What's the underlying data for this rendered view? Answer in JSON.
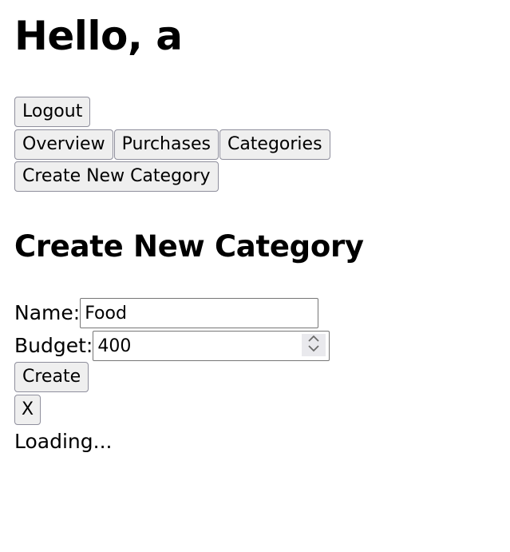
{
  "header": {
    "greeting": "Hello, a"
  },
  "account": {
    "logout_label": "Logout"
  },
  "nav": {
    "overview_label": "Overview",
    "purchases_label": "Purchases",
    "categories_label": "Categories",
    "create_category_label": "Create New Category"
  },
  "form": {
    "title": "Create New Category",
    "name_label": "Name:",
    "name_value": "Food",
    "budget_label": "Budget:",
    "budget_value": "400",
    "create_label": "Create",
    "close_label": "X"
  },
  "status": {
    "loading_text": "Loading..."
  }
}
